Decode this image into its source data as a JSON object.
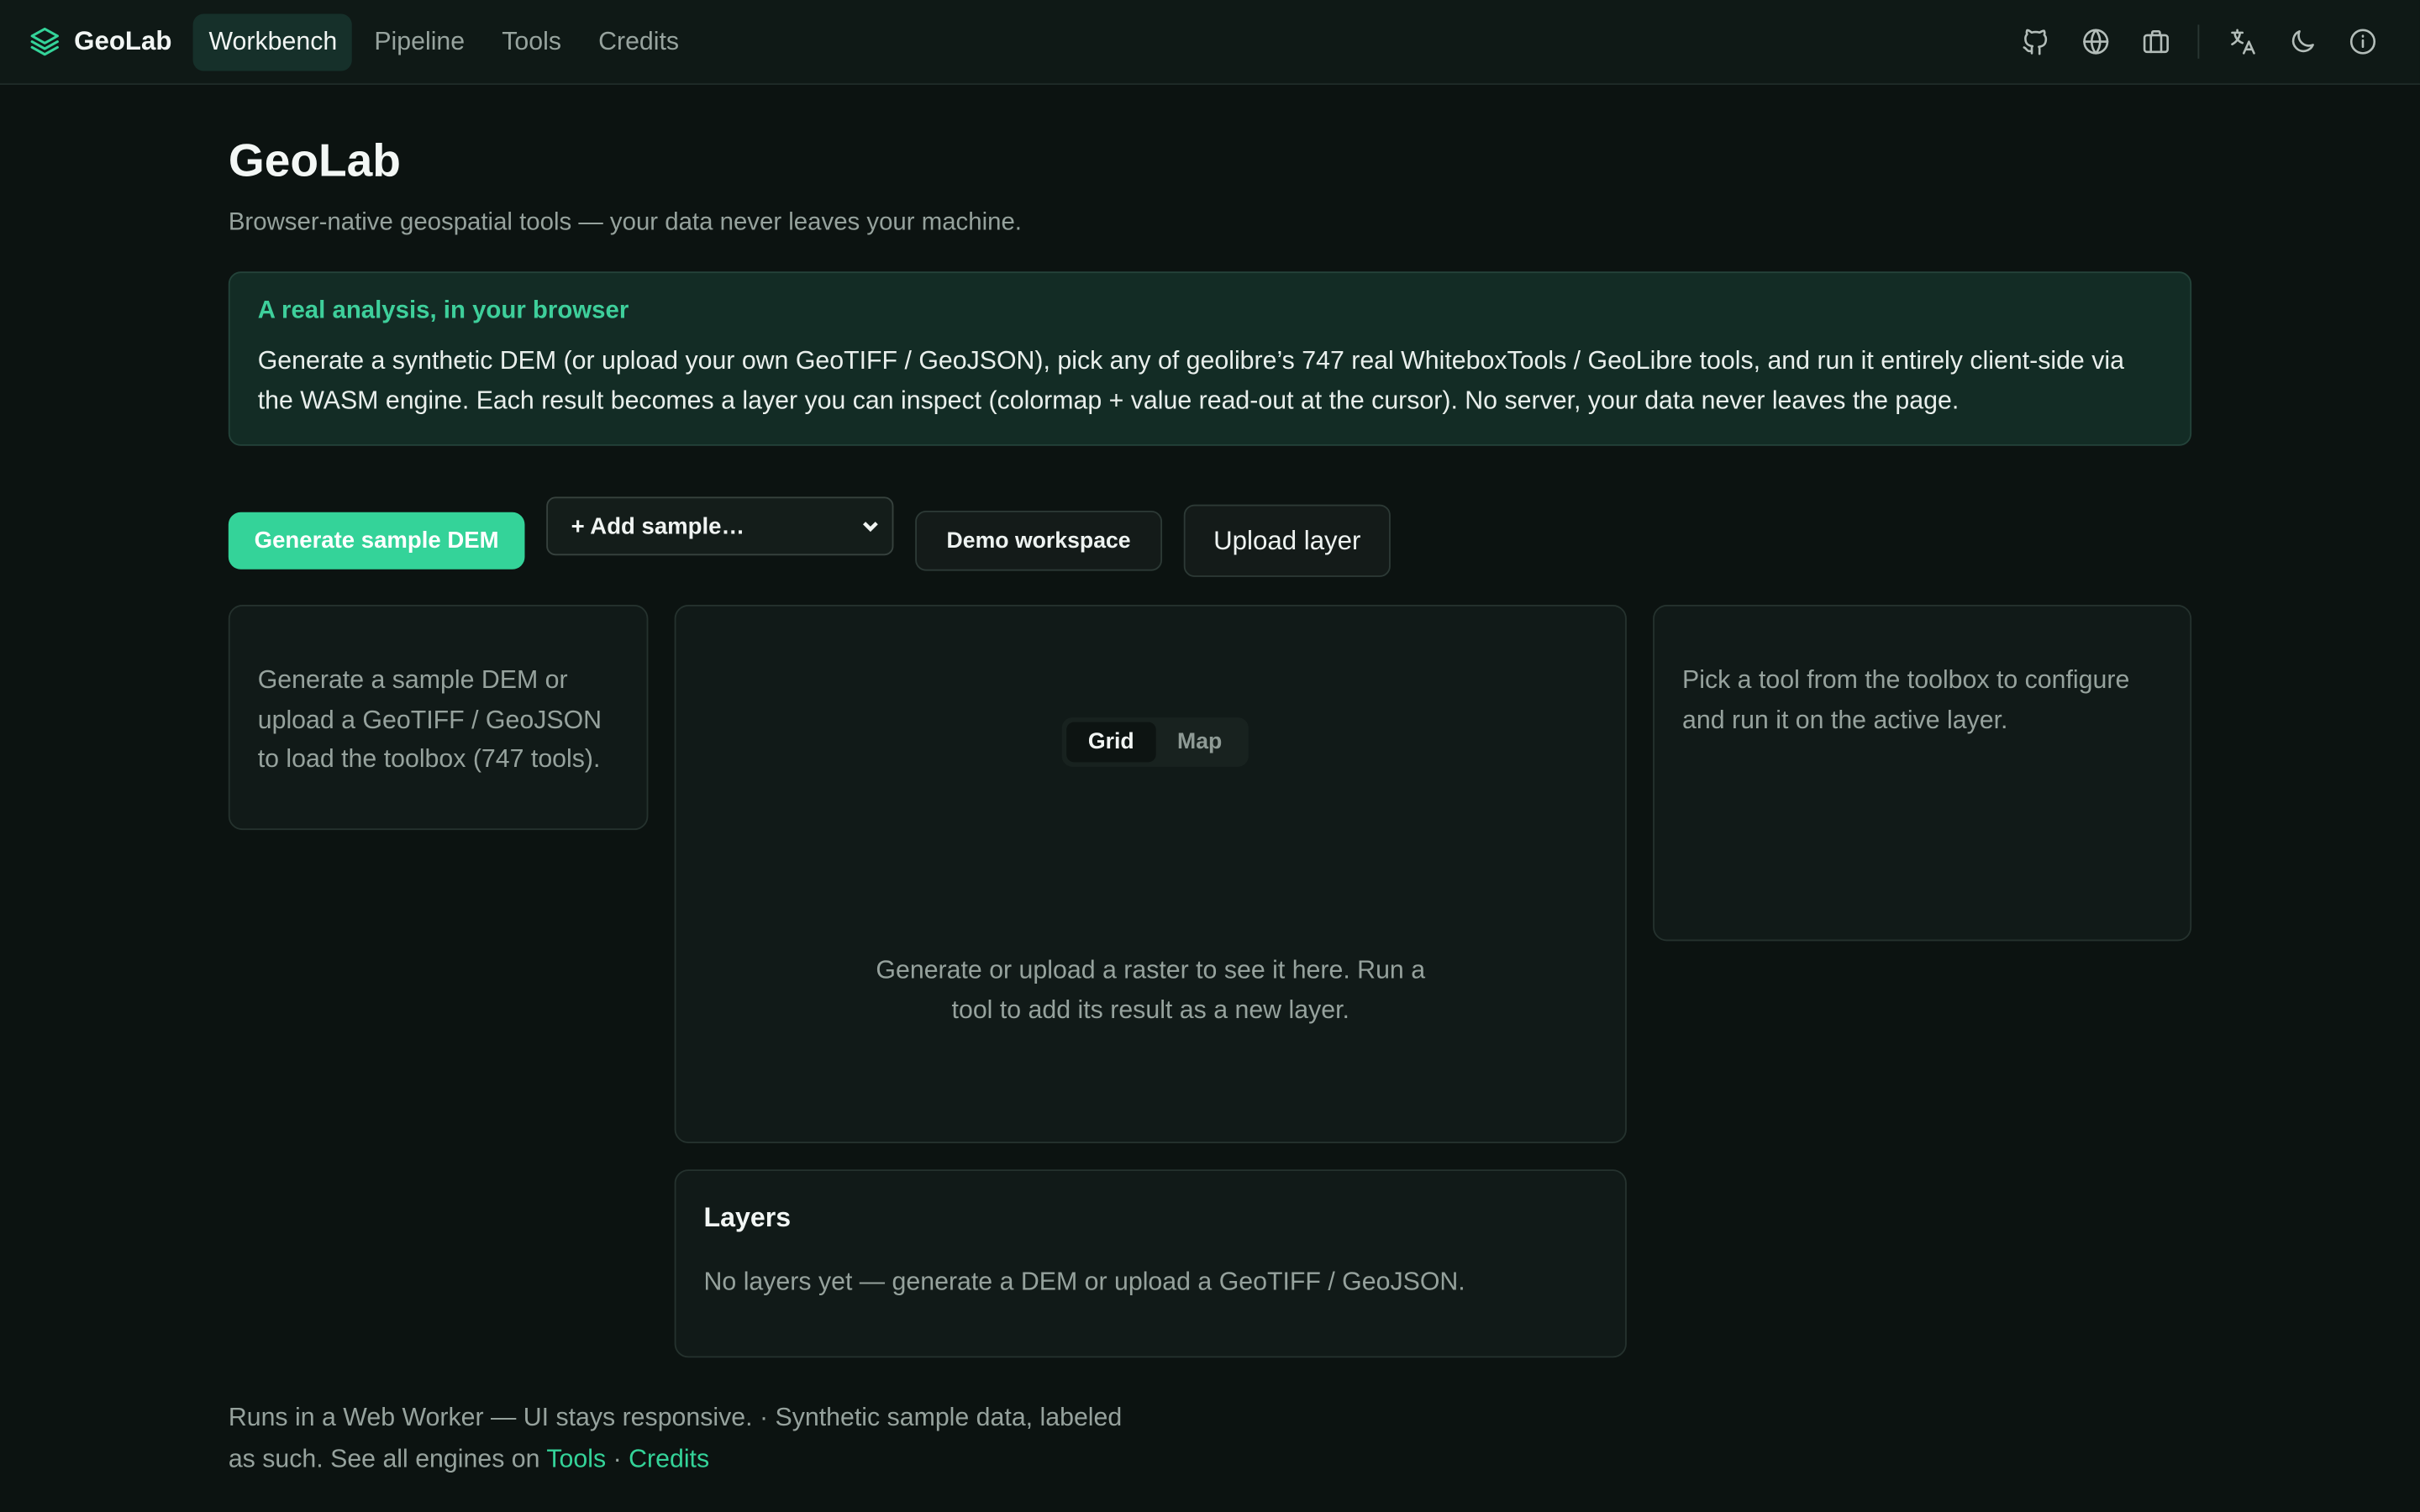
{
  "brand": {
    "name": "GeoLab",
    "logo_icon": "layers-icon"
  },
  "nav": {
    "items": [
      {
        "label": "Workbench",
        "active": true
      },
      {
        "label": "Pipeline",
        "active": false
      },
      {
        "label": "Tools",
        "active": false
      },
      {
        "label": "Credits",
        "active": false
      }
    ],
    "right_icons": [
      "github-icon",
      "globe-icon",
      "briefcase-icon",
      "translate-icon",
      "moon-icon",
      "info-icon"
    ]
  },
  "header": {
    "title": "GeoLab",
    "subtitle": "Browser-native geospatial tools — your data never leaves your machine."
  },
  "callout": {
    "title": "A real analysis, in your browser",
    "body": "Generate a synthetic DEM (or upload your own GeoTIFF / GeoJSON), pick any of geolibre’s 747 real WhiteboxTools / GeoLibre tools, and run it entirely client-side via the WASM engine. Each result becomes a layer you can inspect (colormap + value read-out at the cursor). No server, your data never leaves the page."
  },
  "actions": {
    "generate_label": "Generate sample DEM",
    "add_sample_selected": "+ Add sample…",
    "demo_label": "Demo workspace",
    "upload_label": "Upload layer"
  },
  "toolbox": {
    "empty_text": "Generate a sample DEM or upload a GeoTIFF / GeoJSON to load the toolbox (747 tools)."
  },
  "viewer": {
    "view_modes": [
      "Grid",
      "Map"
    ],
    "active_mode": "Grid",
    "empty_text": "Generate or upload a raster to see it here. Run a tool to add its result as a new layer."
  },
  "tool_panel": {
    "empty_text": "Pick a tool from the toolbox to configure and run it on the active layer."
  },
  "layers": {
    "title": "Layers",
    "empty_text": "No layers yet — generate a DEM or upload a GeoTIFF / GeoJSON."
  },
  "footer": {
    "text": "Runs in a Web Worker — UI stays responsive. · Synthetic sample data, labeled as such. See all engines on",
    "link_tools": "Tools",
    "separator": "·",
    "link_credits": "Credits"
  },
  "colors": {
    "background": "#0c1311",
    "accent": "#34d399",
    "callout_bg": "#132c25"
  }
}
